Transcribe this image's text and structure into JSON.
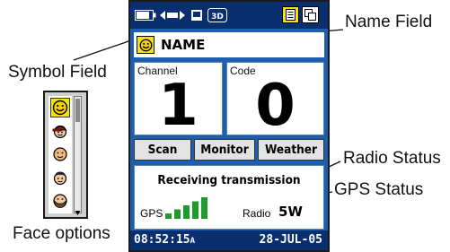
{
  "callouts": {
    "name_field": "Name Field",
    "symbol_field": "Symbol Field",
    "radio_status": "Radio Status",
    "gps_status": "GPS Status",
    "face_options": "Face options"
  },
  "device": {
    "name_value": "NAME",
    "channel": {
      "label": "Channel",
      "value": "1"
    },
    "code": {
      "label": "Code",
      "value": "0"
    },
    "buttons": {
      "scan": "Scan",
      "monitor": "Monitor",
      "weather": "Weather"
    },
    "status_message": "Receiving transmission",
    "gps_label": "GPS",
    "radio_label": "Radio",
    "radio_power": "5W",
    "gps_signal_bars": 5,
    "time": "08:52:15",
    "time_suffix": "A",
    "date": "28-JUL-05"
  },
  "face_options_list": [
    "smiley-face-icon",
    "cap-face-icon",
    "plain-face-icon",
    "hair-face-icon",
    "beard-face-icon"
  ],
  "colors": {
    "screen_bg": "#1b5fae",
    "bar_bg": "#0a2f6e",
    "signal_green": "#1f9a2c",
    "highlight_yellow": "#f2e600"
  }
}
